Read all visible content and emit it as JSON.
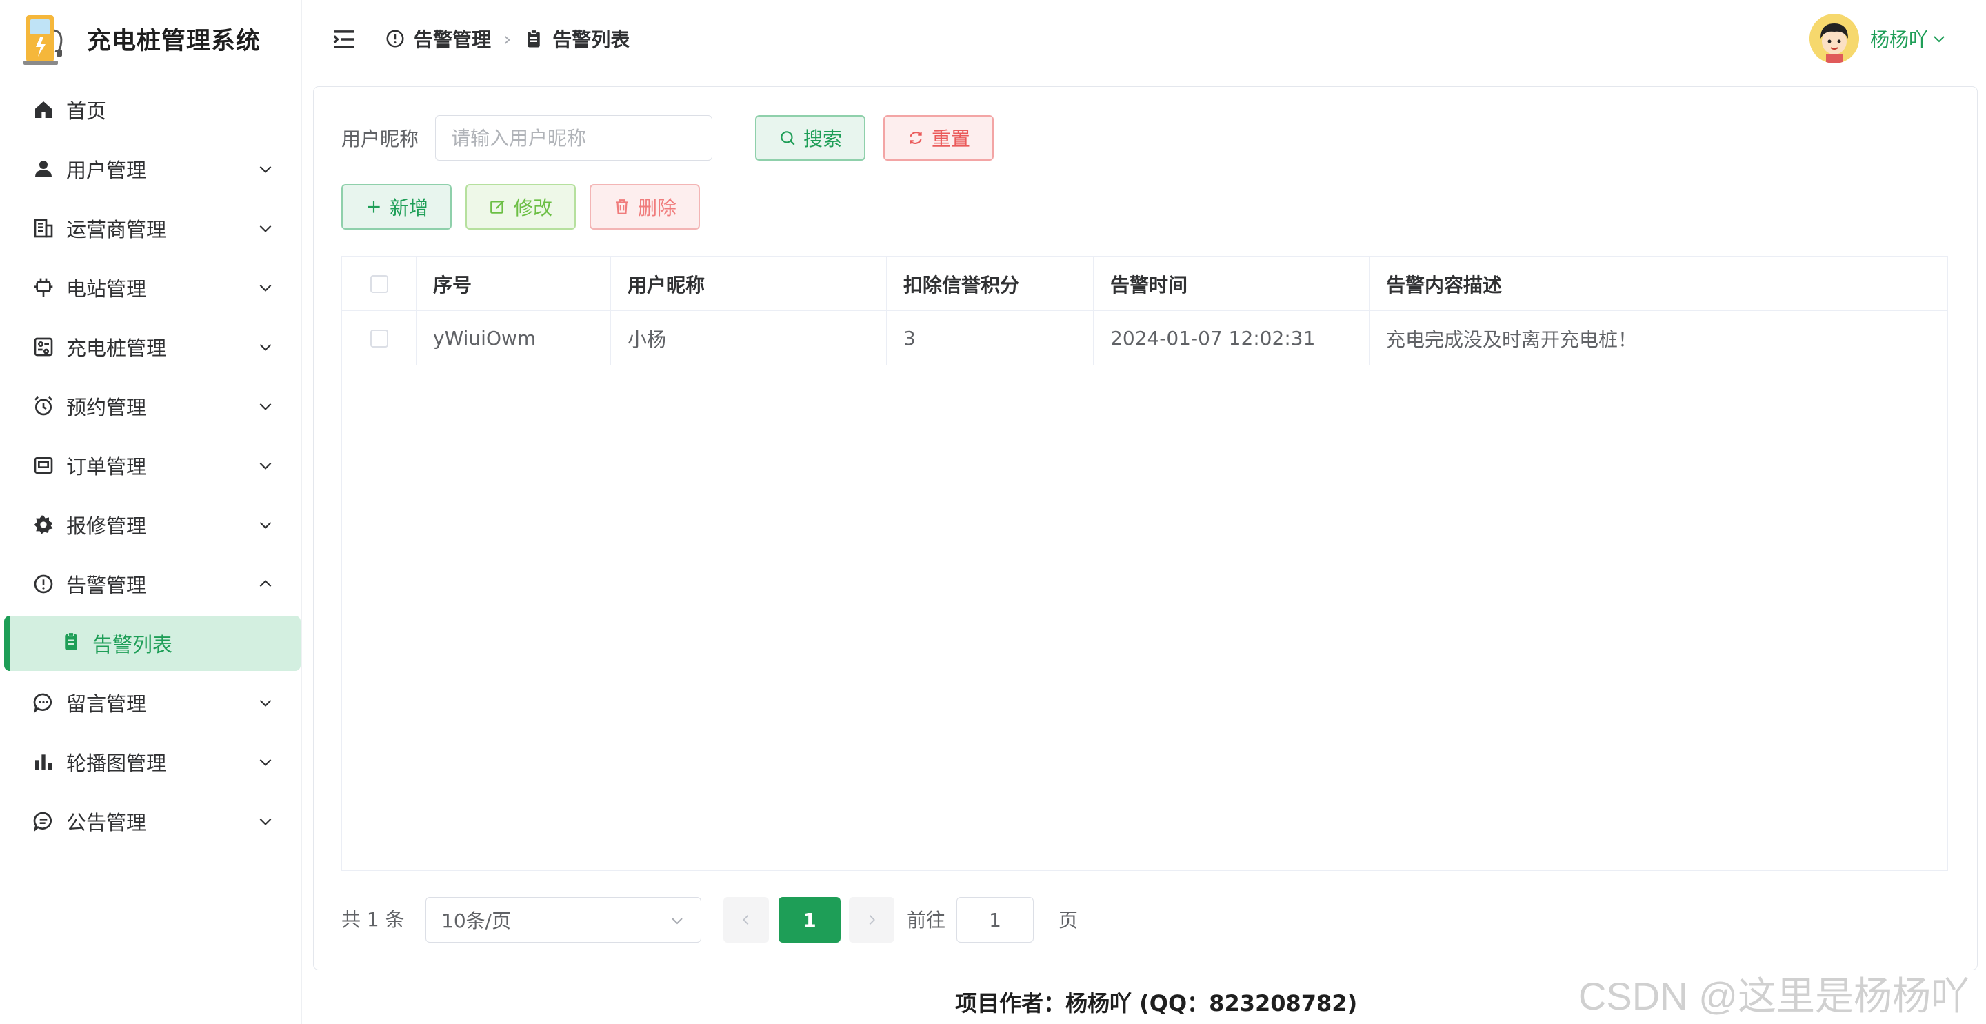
{
  "app": {
    "title": "充电桩管理系统"
  },
  "sidebar": {
    "items": [
      {
        "label": "首页"
      },
      {
        "label": "用户管理"
      },
      {
        "label": "运营商管理"
      },
      {
        "label": "电站管理"
      },
      {
        "label": "充电桩管理"
      },
      {
        "label": "预约管理"
      },
      {
        "label": "订单管理"
      },
      {
        "label": "报修管理"
      },
      {
        "label": "告警管理"
      },
      {
        "label": "告警列表"
      },
      {
        "label": "留言管理"
      },
      {
        "label": "轮播图管理"
      },
      {
        "label": "公告管理"
      }
    ]
  },
  "header": {
    "breadcrumb": [
      "告警管理",
      "告警列表"
    ],
    "user_name": "杨杨吖"
  },
  "search": {
    "label": "用户昵称",
    "placeholder": "请输入用户昵称",
    "search_label": "搜索",
    "reset_label": "重置"
  },
  "actions": {
    "add": "新增",
    "edit": "修改",
    "delete": "删除"
  },
  "table": {
    "columns": [
      "序号",
      "用户昵称",
      "扣除信誉积分",
      "告警时间",
      "告警内容描述"
    ],
    "rows": [
      [
        "yWiuiOwm",
        "小杨",
        "3",
        "2024-01-07 12:02:31",
        "充电完成没及时离开充电桩！"
      ]
    ]
  },
  "pagination": {
    "total_text": "共 1 条",
    "page_size": "10条/页",
    "current_page": "1",
    "goto_label": "前往",
    "goto_value": "1",
    "goto_unit": "页"
  },
  "footer": {
    "text": "项目作者：杨杨吖 (QQ：823208782)"
  },
  "watermark": "CSDN @这里是杨杨吖",
  "colors": {
    "primary": "#1e9e57",
    "danger": "#ea5a5a",
    "active_bg": "#d3efe0"
  }
}
